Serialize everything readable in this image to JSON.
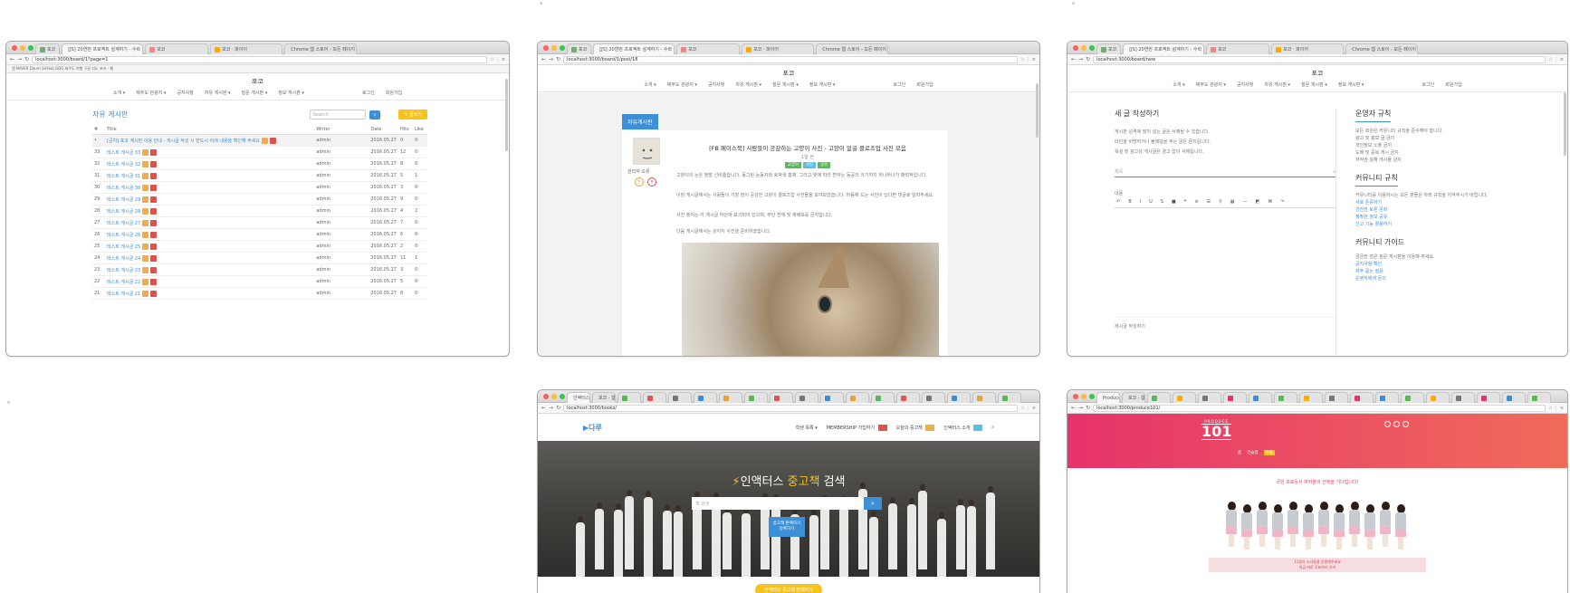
{
  "tabs": {
    "t1": "포코",
    "t2": "[JS] 20연번 프로젝트 설계하기 - 수락",
    "t3": "포코",
    "t4": "포코 ‧ 파이어",
    "t5": "Chrome 웹 스토어 - 모든 페이지",
    "b_t1": "인액터스",
    "b_t2": "포코 - 웹사이트 - 검색",
    "b_t3": "Produce 101"
  },
  "urls": {
    "w1": "localhost:3000/board/1?page=1",
    "w2": "localhost:3000/board/1/post/18",
    "w3": "localhost:3000/board/new",
    "w5": "localhost:3000/books/",
    "w6": "localhost:3000/produce101/"
  },
  "bookmarks": "앱  NAVER  Daum  GitHub  GDG  제주도 여행  구글 지도  포코 - 웹",
  "site": {
    "title": "포코",
    "nav": [
      "소개 ▾",
      "제주도 관광지 ▾",
      "공지사항",
      "자유 게시판 ▾",
      "질문 게시판 ▾",
      "정보 게시판 ▾",
      "로그인",
      "회원가입"
    ]
  },
  "board": {
    "title": "자유 게시판",
    "search_placeholder": "Search",
    "write_label": "✎ 글쓰기",
    "headers": [
      "#",
      "Title",
      "Writer",
      "Date",
      "Hits",
      "Like"
    ],
    "pinned": "[공지] 포코 게시판 이용 안내 - 게시글 작성 시 반드시 아래 내용을 확인해 주세요",
    "rows": [
      {
        "n": "33",
        "t": "테스트 게시글 33",
        "w": "admin",
        "d": "2016.05.27",
        "h": "12",
        "l": "0"
      },
      {
        "n": "32",
        "t": "테스트 게시글 32",
        "w": "admin",
        "d": "2016.05.27",
        "h": "8",
        "l": "0"
      },
      {
        "n": "31",
        "t": "테스트 게시글 31",
        "w": "admin",
        "d": "2016.05.27",
        "h": "5",
        "l": "1"
      },
      {
        "n": "30",
        "t": "테스트 게시글 30",
        "w": "admin",
        "d": "2016.05.27",
        "h": "3",
        "l": "0"
      },
      {
        "n": "29",
        "t": "테스트 게시글 29",
        "w": "admin",
        "d": "2016.05.27",
        "h": "9",
        "l": "0"
      },
      {
        "n": "28",
        "t": "테스트 게시글 28",
        "w": "admin",
        "d": "2016.05.27",
        "h": "4",
        "l": "2"
      },
      {
        "n": "27",
        "t": "테스트 게시글 27",
        "w": "admin",
        "d": "2016.05.27",
        "h": "7",
        "l": "0"
      },
      {
        "n": "26",
        "t": "테스트 게시글 26",
        "w": "admin",
        "d": "2016.05.27",
        "h": "6",
        "l": "0"
      },
      {
        "n": "25",
        "t": "테스트 게시글 25",
        "w": "admin",
        "d": "2016.05.27",
        "h": "2",
        "l": "0"
      },
      {
        "n": "24",
        "t": "테스트 게시글 24",
        "w": "admin",
        "d": "2016.05.27",
        "h": "11",
        "l": "1"
      },
      {
        "n": "23",
        "t": "테스트 게시글 23",
        "w": "admin",
        "d": "2016.05.27",
        "h": "3",
        "l": "0"
      },
      {
        "n": "22",
        "t": "테스트 게시글 22",
        "w": "admin",
        "d": "2016.05.27",
        "h": "5",
        "l": "0"
      },
      {
        "n": "21",
        "t": "테스트 게시글 21",
        "w": "admin",
        "d": "2016.05.27",
        "h": "8",
        "l": "0"
      }
    ]
  },
  "post": {
    "badge": "자유게시판",
    "title": "[FB 페이스북] 사람들이 공감하는 고양이 사진 - 고양이 얼굴 클로즈업 사진 모음",
    "meta": "1일 전",
    "tags": [
      "고양이",
      "사진",
      "공유"
    ],
    "author": "관리자 오류",
    "para1": "고양이의 눈은 정말 신비롭습니다. 동그란 눈동자와 호박색 홍채, 그리고 빛에 따라 변하는 동공의 크기까지 하나하나가 매력적입니다.",
    "para2": "이번 게시글에서는 사람들이 가장 많이 공감한 고양이 클로즈업 사진들을 모아보았습니다. 마음에 드는 사진이 있다면 댓글로 알려주세요.",
    "para3": "사진 출처는 각 게시글 하단에 표기되어 있으며, 무단 전재 및 재배포를 금지합니다.",
    "para4": "다음 게시글에서는 강아지 사진을 준비하겠습니다."
  },
  "write": {
    "heading": "새 글 작성하기",
    "notes": [
      "게시판 성격에 맞지 않는 글은 삭제될 수 있습니다.",
      "타인을 비방하거나 불쾌감을 주는 글은 금지됩니다.",
      "욕설 및 광고성 게시글은 경고 없이 삭제됩니다."
    ],
    "title_placeholder": "제목",
    "body_label": "내용",
    "rules_heading": "운영자 규칙",
    "rules": [
      "모든 회원은 커뮤니티 규칙을 준수해야 합니다.",
      "광고 및 홍보 글 금지",
      "개인정보 노출 금지",
      "도배 및 중복 게시 금지",
      "저작권 침해 게시물 금지"
    ],
    "community_heading": "커뮤니티 규칙",
    "community_text": "커뮤니티를 이용하시는 모든 분들은 아래 규칙을 지켜주시기 바랍니다.",
    "community_items": [
      "서로 존중하기",
      "건전한 토론 문화",
      "정확한 정보 공유",
      "신고 기능 활용하기"
    ],
    "guide_heading": "커뮤니티 가이드",
    "guide_text": "궁금한 점은 질문 게시판을 이용해 주세요.",
    "guide_items": [
      "공지사항 확인",
      "자주 묻는 질문",
      "운영자에게 문의"
    ],
    "footer": "게시글 작성하기"
  },
  "enactus": {
    "brand": "다루",
    "nav": [
      "학생 목록 ▾",
      "MEMBERSHIP 가입하기",
      "오늘의 중고책",
      "인액터스 소개"
    ],
    "hero_title_a": "인액터스 ",
    "hero_title_b": "중고책",
    "hero_title_c": " 검색",
    "search_placeholder": "책 검색",
    "cta": "중고책 판매하기\n등록하기",
    "bottom_btn": "인액터스 중고책 판매하기"
  },
  "produce": {
    "logo_top": "PRODUCE",
    "logo_num": "101",
    "links": [
      "홈",
      "연습생",
      "투표"
    ],
    "headline": "국민 프로듀서 여러분의 선택을 기다립니다!",
    "caption1": "11명의 소녀들을 응원해주세요",
    "caption2": "지금 바로 투표하러 가기"
  }
}
